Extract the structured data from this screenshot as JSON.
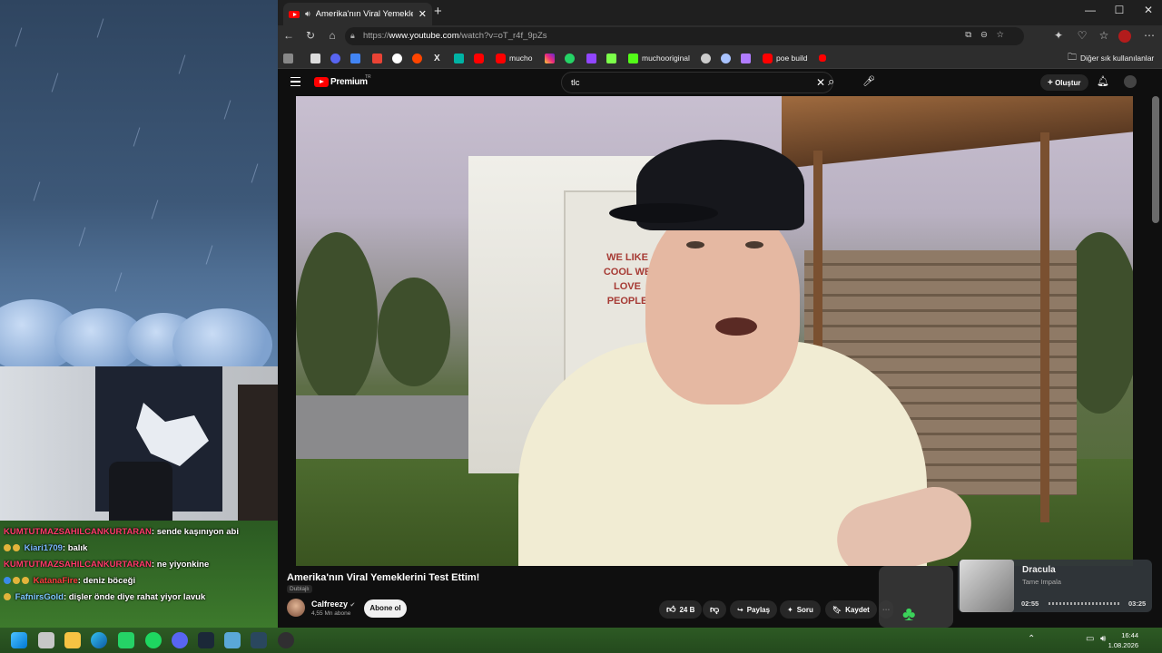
{
  "chat": {
    "lines": [
      {
        "user": "KUMTUTMAZSAHILCANKURTARAN",
        "text": ": sende kaşınıyon abi",
        "color": "#ff3b6b"
      },
      {
        "user": "Kiari1709",
        "text": ": balık",
        "color": "#7ab8ff"
      },
      {
        "user": "KUMTUTMAZSAHILCANKURTARAN",
        "text": ": ne yiyonkine",
        "color": "#ff3b6b"
      },
      {
        "user": "KatanaFire",
        "text": ": deniz böceği",
        "color": "#ff4040"
      },
      {
        "user": "FafnirsGold",
        "text": ": dişler önde diye rahat yiyor lavuk",
        "color": "#7ec8ff"
      }
    ]
  },
  "browser": {
    "tab_title": "Amerika'nın Viral Yemeklerini",
    "url_prefix": "https://",
    "url_host": "www.youtube.com",
    "url_path": "/watch?v=oT_r4f_9pZs",
    "new_tab": "+",
    "bookmarks": [
      {
        "label": "mucho",
        "color": "#ff0000"
      },
      {
        "label": "muchooriginal",
        "color": "#53fc18"
      },
      {
        "label": "poe build",
        "color": "#ff0000"
      }
    ],
    "other_bookmarks": "Diğer sık kullanılanlar"
  },
  "youtube": {
    "brand": "Premium",
    "brand_sup": "TR",
    "search_value": "tlc",
    "create_label": "Oluştur",
    "video_title": "Amerika'nın Viral Yemeklerini Test Ettim!",
    "dub_badge": "Dublajlı",
    "channel": "Calfreezy",
    "subscribers": "4,55 Mn abone",
    "subscribe": "Abone ol",
    "likes": "24 B",
    "share": "Paylaş",
    "ask": "Soru",
    "save": "Kaydet",
    "trailer_text": "WE LIKE COOL WE LOVE PEOPLE"
  },
  "music": {
    "song": "Dracula",
    "artist": "Tame Impala",
    "elapsed": "02:55",
    "duration": "03:25",
    "progress": 0.86
  },
  "taskbar": {
    "time": "16:44",
    "date": "1.08.2026"
  }
}
